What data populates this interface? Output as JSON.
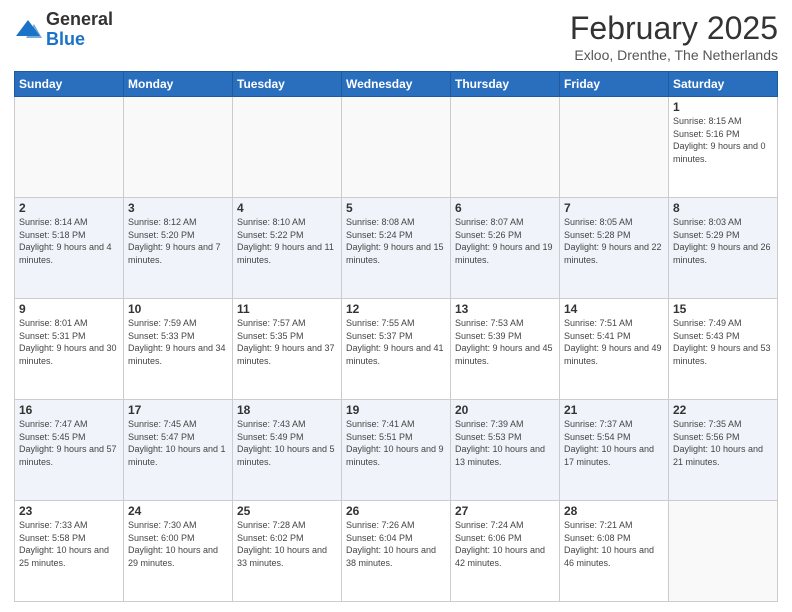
{
  "header": {
    "logo": {
      "general": "General",
      "blue": "Blue"
    },
    "title": "February 2025",
    "location": "Exloo, Drenthe, The Netherlands"
  },
  "weekdays": [
    "Sunday",
    "Monday",
    "Tuesday",
    "Wednesday",
    "Thursday",
    "Friday",
    "Saturday"
  ],
  "weeks": [
    [
      {
        "day": "",
        "info": ""
      },
      {
        "day": "",
        "info": ""
      },
      {
        "day": "",
        "info": ""
      },
      {
        "day": "",
        "info": ""
      },
      {
        "day": "",
        "info": ""
      },
      {
        "day": "",
        "info": ""
      },
      {
        "day": "1",
        "info": "Sunrise: 8:15 AM\nSunset: 5:16 PM\nDaylight: 9 hours and 0 minutes."
      }
    ],
    [
      {
        "day": "2",
        "info": "Sunrise: 8:14 AM\nSunset: 5:18 PM\nDaylight: 9 hours and 4 minutes."
      },
      {
        "day": "3",
        "info": "Sunrise: 8:12 AM\nSunset: 5:20 PM\nDaylight: 9 hours and 7 minutes."
      },
      {
        "day": "4",
        "info": "Sunrise: 8:10 AM\nSunset: 5:22 PM\nDaylight: 9 hours and 11 minutes."
      },
      {
        "day": "5",
        "info": "Sunrise: 8:08 AM\nSunset: 5:24 PM\nDaylight: 9 hours and 15 minutes."
      },
      {
        "day": "6",
        "info": "Sunrise: 8:07 AM\nSunset: 5:26 PM\nDaylight: 9 hours and 19 minutes."
      },
      {
        "day": "7",
        "info": "Sunrise: 8:05 AM\nSunset: 5:28 PM\nDaylight: 9 hours and 22 minutes."
      },
      {
        "day": "8",
        "info": "Sunrise: 8:03 AM\nSunset: 5:29 PM\nDaylight: 9 hours and 26 minutes."
      }
    ],
    [
      {
        "day": "9",
        "info": "Sunrise: 8:01 AM\nSunset: 5:31 PM\nDaylight: 9 hours and 30 minutes."
      },
      {
        "day": "10",
        "info": "Sunrise: 7:59 AM\nSunset: 5:33 PM\nDaylight: 9 hours and 34 minutes."
      },
      {
        "day": "11",
        "info": "Sunrise: 7:57 AM\nSunset: 5:35 PM\nDaylight: 9 hours and 37 minutes."
      },
      {
        "day": "12",
        "info": "Sunrise: 7:55 AM\nSunset: 5:37 PM\nDaylight: 9 hours and 41 minutes."
      },
      {
        "day": "13",
        "info": "Sunrise: 7:53 AM\nSunset: 5:39 PM\nDaylight: 9 hours and 45 minutes."
      },
      {
        "day": "14",
        "info": "Sunrise: 7:51 AM\nSunset: 5:41 PM\nDaylight: 9 hours and 49 minutes."
      },
      {
        "day": "15",
        "info": "Sunrise: 7:49 AM\nSunset: 5:43 PM\nDaylight: 9 hours and 53 minutes."
      }
    ],
    [
      {
        "day": "16",
        "info": "Sunrise: 7:47 AM\nSunset: 5:45 PM\nDaylight: 9 hours and 57 minutes."
      },
      {
        "day": "17",
        "info": "Sunrise: 7:45 AM\nSunset: 5:47 PM\nDaylight: 10 hours and 1 minute."
      },
      {
        "day": "18",
        "info": "Sunrise: 7:43 AM\nSunset: 5:49 PM\nDaylight: 10 hours and 5 minutes."
      },
      {
        "day": "19",
        "info": "Sunrise: 7:41 AM\nSunset: 5:51 PM\nDaylight: 10 hours and 9 minutes."
      },
      {
        "day": "20",
        "info": "Sunrise: 7:39 AM\nSunset: 5:53 PM\nDaylight: 10 hours and 13 minutes."
      },
      {
        "day": "21",
        "info": "Sunrise: 7:37 AM\nSunset: 5:54 PM\nDaylight: 10 hours and 17 minutes."
      },
      {
        "day": "22",
        "info": "Sunrise: 7:35 AM\nSunset: 5:56 PM\nDaylight: 10 hours and 21 minutes."
      }
    ],
    [
      {
        "day": "23",
        "info": "Sunrise: 7:33 AM\nSunset: 5:58 PM\nDaylight: 10 hours and 25 minutes."
      },
      {
        "day": "24",
        "info": "Sunrise: 7:30 AM\nSunset: 6:00 PM\nDaylight: 10 hours and 29 minutes."
      },
      {
        "day": "25",
        "info": "Sunrise: 7:28 AM\nSunset: 6:02 PM\nDaylight: 10 hours and 33 minutes."
      },
      {
        "day": "26",
        "info": "Sunrise: 7:26 AM\nSunset: 6:04 PM\nDaylight: 10 hours and 38 minutes."
      },
      {
        "day": "27",
        "info": "Sunrise: 7:24 AM\nSunset: 6:06 PM\nDaylight: 10 hours and 42 minutes."
      },
      {
        "day": "28",
        "info": "Sunrise: 7:21 AM\nSunset: 6:08 PM\nDaylight: 10 hours and 46 minutes."
      },
      {
        "day": "",
        "info": ""
      }
    ]
  ]
}
